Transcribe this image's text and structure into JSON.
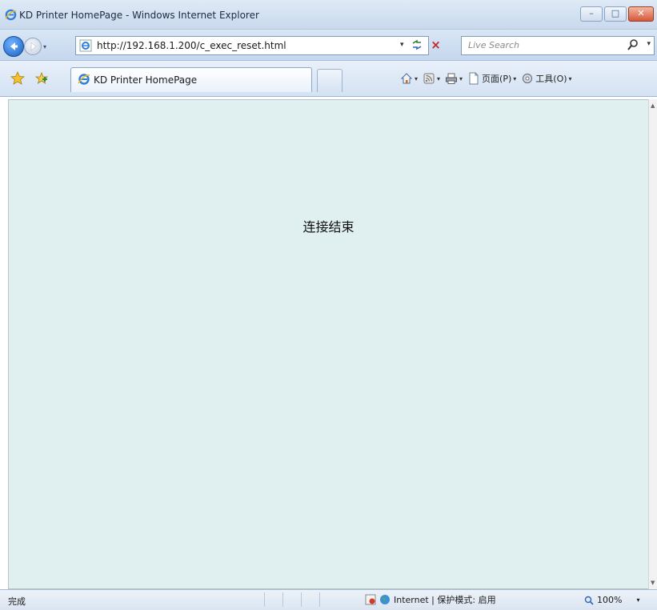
{
  "window": {
    "title": "KD Printer HomePage - Windows Internet Explorer"
  },
  "window_controls": {
    "minimize": "–",
    "maximize": "□",
    "close": "✕"
  },
  "address_bar": {
    "url": "http://192.168.1.200/c_exec_reset.html",
    "dropdown": "▾"
  },
  "search": {
    "placeholder": "Live Search",
    "dropdown": "▾"
  },
  "tab": {
    "label": "KD Printer HomePage"
  },
  "command_bar": {
    "page_label": "页面(P)",
    "tools_label": "工具(O)",
    "dropdown": "▾"
  },
  "content": {
    "message": "连接结束"
  },
  "status_bar": {
    "status_text": "完成",
    "zone": "Internet | 保护模式: 启用",
    "zoom": "100%",
    "zoom_dropdown": "▾"
  },
  "icons": {
    "app": "ie-logo-icon",
    "back": "back-arrow-icon",
    "forward": "forward-arrow-icon",
    "refresh": "refresh-icon",
    "stop": "stop-icon",
    "search": "magnifier-icon",
    "favorites": "star-icon",
    "add_favorite": "add-favorite-icon",
    "home": "home-icon",
    "feeds": "feeds-icon",
    "print": "print-icon",
    "protected_mode": "shield-icon",
    "globe": "globe-icon"
  },
  "colors": {
    "content_background": "#e0eff0",
    "chrome_blue": "#c9d9ec",
    "close_red": "#d6583a"
  }
}
